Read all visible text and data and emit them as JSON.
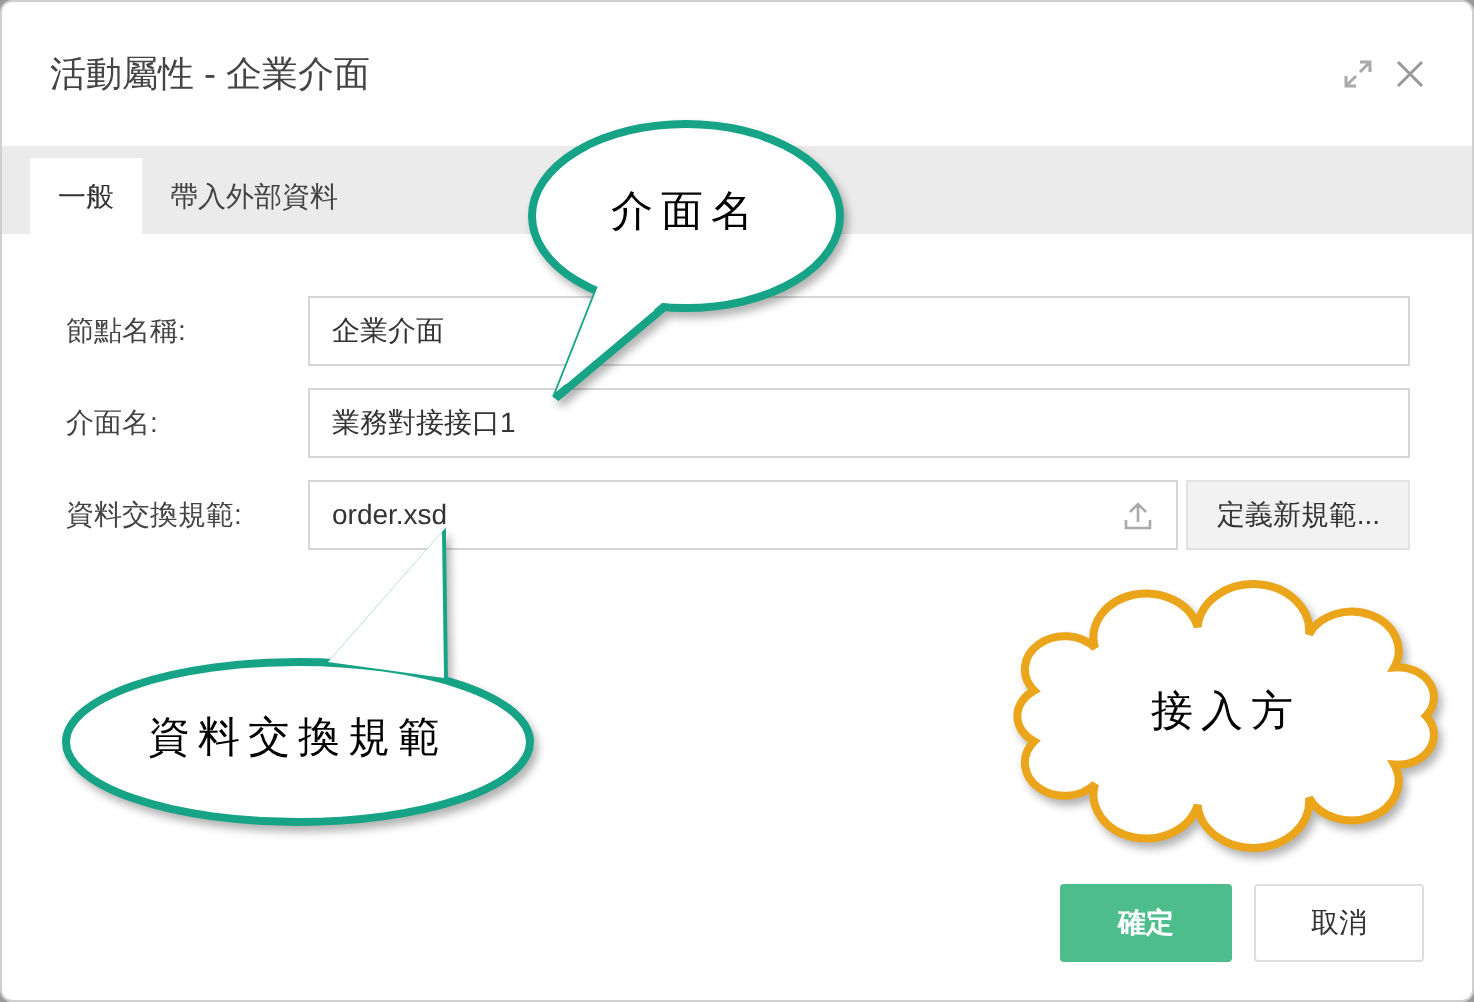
{
  "window": {
    "title": "活動屬性 - 企業介面"
  },
  "tabs": [
    {
      "label": "一般",
      "selected": true
    },
    {
      "label": "帶入外部資料",
      "selected": false
    }
  ],
  "fields": [
    {
      "kind": "text",
      "label": "節點名稱:",
      "value": "企業介面"
    },
    {
      "kind": "text",
      "label": "介面名:",
      "value": "業務對接接口1"
    },
    {
      "kind": "file",
      "label": "資料交換規範:",
      "value": "order.xsd",
      "button": "定義新規範..."
    }
  ],
  "buttons": [
    {
      "kind": "primary",
      "label": "確定"
    },
    {
      "kind": "secondary",
      "label": "取消"
    }
  ],
  "callouts": [
    {
      "kind": "speech",
      "text": "介面名"
    },
    {
      "kind": "speech",
      "text": "資料交換規範"
    },
    {
      "kind": "cloud",
      "text": "接入方"
    }
  ]
}
